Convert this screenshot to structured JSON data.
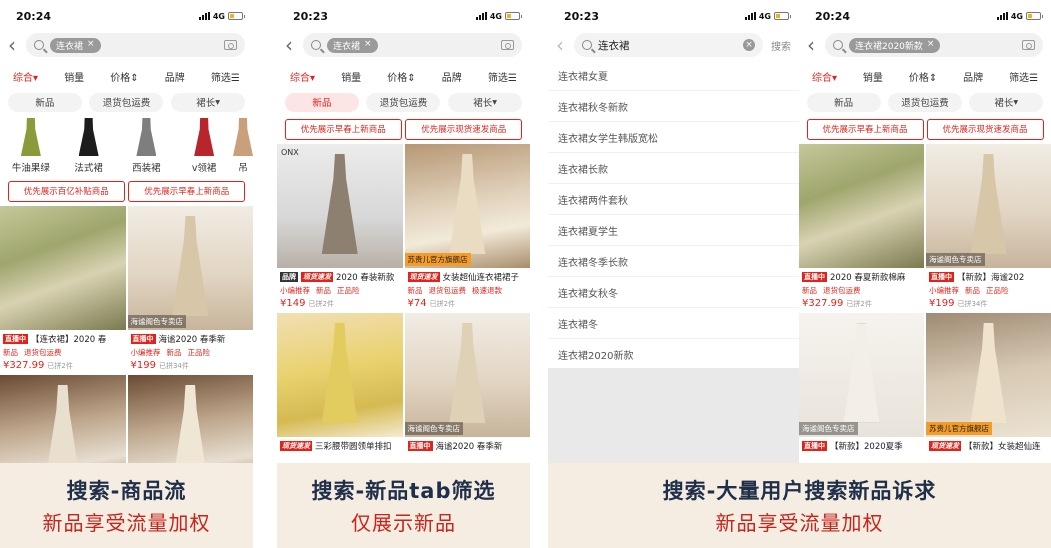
{
  "screens": [
    {
      "time": "20:24",
      "network": "4G",
      "chips": [
        "连衣裙"
      ],
      "sorts": [
        "综合",
        "销量",
        "价格",
        "品牌",
        "筛选"
      ],
      "filters": [
        "新品",
        "退货包运费",
        "裙长"
      ],
      "categories": [
        "牛油果绿",
        "法式裙",
        "西装裙",
        "v领裙",
        "吊"
      ],
      "tag_buttons": [
        "优先展示百亿补贴商品",
        "优先展示早春上新商品"
      ],
      "products": [
        {
          "badge": "直播中",
          "title": "【连衣裙】2020 春",
          "meta": [
            "新品",
            "退货包运费"
          ],
          "price": "¥327.99",
          "sold": "已拼2件",
          "shop": ""
        },
        {
          "badge": "直播中",
          "title": "海谧2020 春季新",
          "meta": [
            "小编推荐",
            "新品",
            "正品险"
          ],
          "price": "¥199",
          "sold": "已拼34件",
          "shop": "海谧阁色专卖店"
        }
      ]
    },
    {
      "time": "20:23",
      "network": "4G",
      "chips": [
        "连衣裙"
      ],
      "sorts": [
        "综合",
        "销量",
        "价格",
        "品牌",
        "筛选"
      ],
      "filters": [
        "新品",
        "退货包运费",
        "裙长"
      ],
      "tag_buttons": [
        "优先展示早春上新商品",
        "优先展示现货速发商品"
      ],
      "products": [
        {
          "badge": "品牌",
          "badge2": "现货速发",
          "title": "2020 春装新款",
          "meta": [
            "小编推荐",
            "新品",
            "正品险"
          ],
          "price": "¥149",
          "sold": "已拼2件",
          "shop": "",
          "logo": "ONX"
        },
        {
          "badge": "现货速发",
          "title": "女装超仙连衣裙裙子",
          "meta": [
            "新品",
            "退货包运费",
            "极速退款"
          ],
          "price": "¥74",
          "sold": "已拼2件",
          "shop": "苏贵儿官方旗舰店"
        },
        {
          "badge": "现货速发",
          "title": "三彩腰带圆领单排扣",
          "meta": [],
          "price": "",
          "sold": "",
          "shop": ""
        },
        {
          "badge": "直播中",
          "title": "海谧2020 春季新",
          "meta": [],
          "price": "",
          "sold": "",
          "shop": "海谧阁色专卖店"
        }
      ]
    },
    {
      "time": "20:23",
      "network": "4G",
      "query": "连衣裙",
      "cancel": "搜索",
      "suggestions": [
        "连衣裙女夏",
        "连衣裙秋冬新款",
        "连衣裙女学生韩版宽松",
        "连衣裙长款",
        "连衣裙两件套秋",
        "连衣裙夏学生",
        "连衣裙冬季长款",
        "连衣裙女秋冬",
        "连衣裙冬",
        "连衣裙2020新款"
      ]
    },
    {
      "time": "20:24",
      "network": "4G",
      "chips": [
        "连衣裙2020新款"
      ],
      "sorts": [
        "综合",
        "销量",
        "价格",
        "品牌",
        "筛选"
      ],
      "filters": [
        "新品",
        "退货包运费",
        "裙长"
      ],
      "tag_buttons": [
        "优先展示早春上新商品",
        "优先展示现货速发商品"
      ],
      "products": [
        {
          "badge": "直播中",
          "title": "2020 春夏新款棉麻",
          "meta": [
            "新品",
            "退货包运费"
          ],
          "price": "¥327.99",
          "sold": "已拼2件",
          "shop": ""
        },
        {
          "badge": "直播中",
          "title": "【新款】海谧202",
          "meta": [
            "小编推荐",
            "新品",
            "正品险"
          ],
          "price": "¥199",
          "sold": "已拼34件",
          "shop": "海谧阁色专卖店"
        },
        {
          "badge": "直播中",
          "title": "【新款】2020夏季",
          "meta": [],
          "price": "",
          "sold": "",
          "shop": "海谧阁色专卖店"
        },
        {
          "badge": "现货速发",
          "title": "【新款】女装超仙连",
          "meta": [],
          "price": "",
          "sold": "",
          "shop": "苏贵儿官方旗舰店"
        }
      ]
    }
  ],
  "captions": [
    {
      "line1": "搜索-商品流",
      "line2": "新品享受流量加权"
    },
    {
      "line1": "搜索-新品tab筛选",
      "line2": "仅展示新品"
    },
    {
      "line1": "搜索-大量用户搜索新品诉求",
      "line2": "新品享受流量加权"
    }
  ],
  "colors": {
    "accent": "#e2231a",
    "caption_bg": "#f5ede2",
    "caption_title": "#1f2f4a",
    "caption_sub": "#c8241c"
  }
}
